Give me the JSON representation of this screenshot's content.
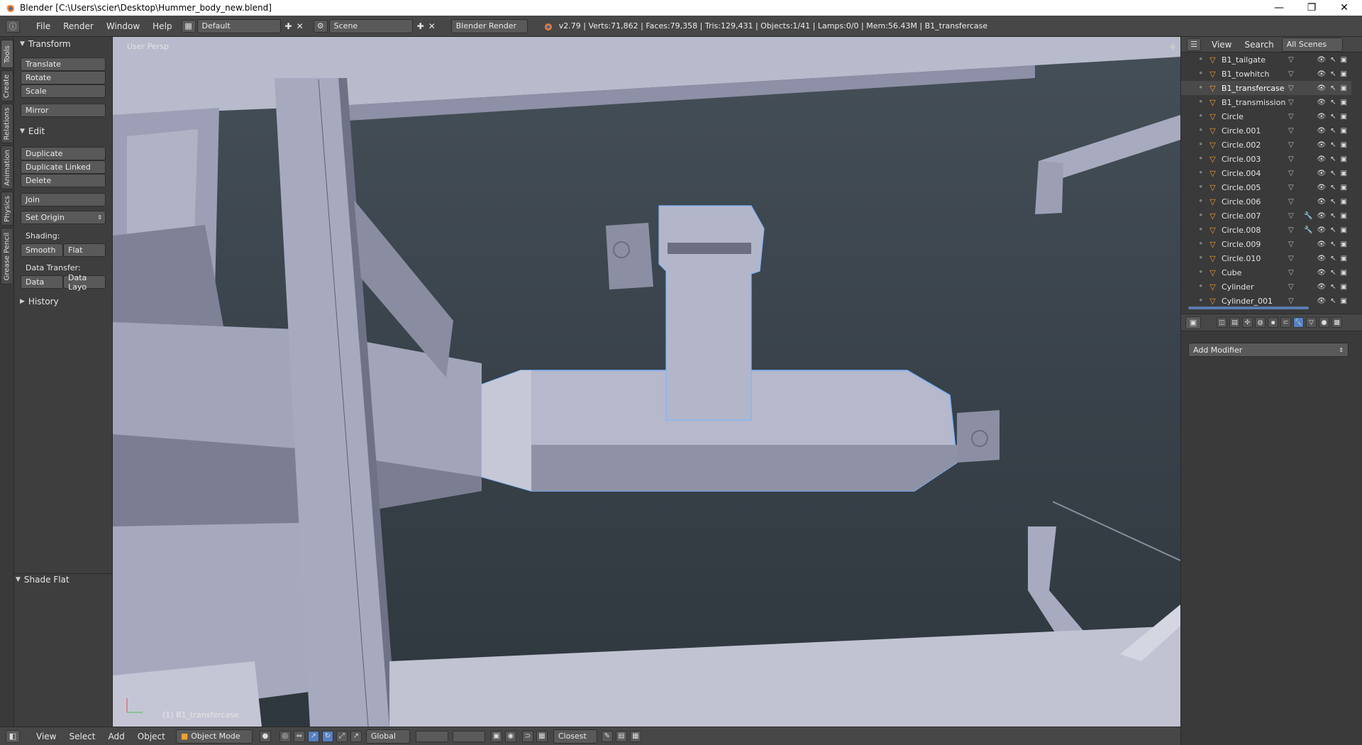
{
  "window": {
    "title": "Blender [C:\\Users\\scier\\Desktop\\Hummer_body_new.blend]",
    "controls": [
      "—",
      "❐",
      "✕"
    ]
  },
  "info_header": {
    "menus": [
      "File",
      "Render",
      "Window",
      "Help"
    ],
    "layout": "Default",
    "scene": "Scene",
    "engine": "Blender Render",
    "stats": "v2.79 | Verts:71,862 | Faces:79,358 | Tris:129,431 | Objects:1/41 | Lamps:0/0 | Mem:56.43M | B1_transfercase"
  },
  "vertical_tabs": [
    "Tools",
    "Create",
    "Relations",
    "Animation",
    "Physics",
    "Grease Pencil"
  ],
  "tool_shelf": {
    "transform": {
      "title": "Transform",
      "buttons": [
        "Translate",
        "Rotate",
        "Scale"
      ],
      "mirror": "Mirror"
    },
    "edit": {
      "title": "Edit",
      "buttons": [
        "Duplicate",
        "Duplicate Linked",
        "Delete"
      ],
      "join": "Join",
      "set_origin": "Set Origin",
      "shading_label": "Shading:",
      "smooth": "Smooth",
      "flat": "Flat",
      "data_transfer_label": "Data Transfer:",
      "data": "Data",
      "data_layo": "Data Layo"
    },
    "history": "History",
    "operator_panel": "Shade Flat"
  },
  "viewport": {
    "view_label": "User Persp",
    "object_label": "(1) B1_transfercase",
    "colors": {
      "bg_top": "#454f58",
      "bg_bottom": "#2f373e",
      "mesh": "#a7a8bd",
      "selection": "#7db6ff"
    }
  },
  "viewport_header": {
    "menus": [
      "View",
      "Select",
      "Add",
      "Object"
    ],
    "mode": "Object Mode",
    "orientation": "Global",
    "snap": "Closest"
  },
  "outliner": {
    "header": {
      "view": "View",
      "search": "Search",
      "filter": "All Scenes"
    },
    "items": [
      {
        "name": "B1_tailgate",
        "selected": false,
        "wrench": false
      },
      {
        "name": "B1_towhitch",
        "selected": false,
        "wrench": false
      },
      {
        "name": "B1_transfercase",
        "selected": true,
        "wrench": false
      },
      {
        "name": "B1_transmission",
        "selected": false,
        "wrench": false
      },
      {
        "name": "Circle",
        "selected": false,
        "wrench": false
      },
      {
        "name": "Circle.001",
        "selected": false,
        "wrench": false
      },
      {
        "name": "Circle.002",
        "selected": false,
        "wrench": false
      },
      {
        "name": "Circle.003",
        "selected": false,
        "wrench": false
      },
      {
        "name": "Circle.004",
        "selected": false,
        "wrench": false
      },
      {
        "name": "Circle.005",
        "selected": false,
        "wrench": false
      },
      {
        "name": "Circle.006",
        "selected": false,
        "wrench": false
      },
      {
        "name": "Circle.007",
        "selected": false,
        "wrench": true
      },
      {
        "name": "Circle.008",
        "selected": false,
        "wrench": true
      },
      {
        "name": "Circle.009",
        "selected": false,
        "wrench": false
      },
      {
        "name": "Circle.010",
        "selected": false,
        "wrench": false
      },
      {
        "name": "Cube",
        "selected": false,
        "wrench": false
      },
      {
        "name": "Cylinder",
        "selected": false,
        "wrench": false
      },
      {
        "name": "Cylinder_001",
        "selected": false,
        "wrench": false
      }
    ]
  },
  "properties": {
    "add_modifier": "Add Modifier",
    "tab_icons": [
      "render-icon",
      "render-layers-icon",
      "scene-icon",
      "world-icon",
      "object-icon",
      "constraints-icon",
      "modifiers-icon",
      "data-icon",
      "material-icon",
      "texture-icon"
    ]
  }
}
